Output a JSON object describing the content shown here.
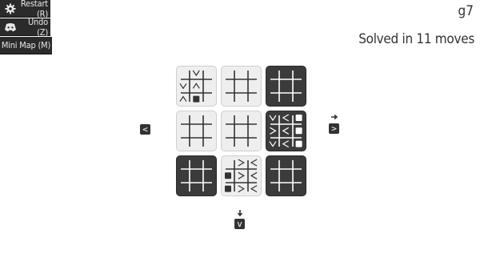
{
  "menu": {
    "restart_label": "Restart (R)",
    "undo_label": "Undo (Z)",
    "minimap_label": "Mini Map (M)",
    "restart_icon": "gear-icon",
    "undo_icon": "discord-icon"
  },
  "status": {
    "level": "g7",
    "solved_text": "Solved in 11 moves"
  },
  "board": {
    "rows": 3,
    "cols": 3,
    "tiles": [
      {
        "shade": "light",
        "marks": [
          [
            0,
            1,
            "v"
          ],
          [
            1,
            0,
            "v"
          ],
          [
            1,
            1,
            "^"
          ],
          [
            2,
            0,
            "^"
          ],
          [
            2,
            1,
            "sq"
          ]
        ]
      },
      {
        "shade": "light",
        "marks": []
      },
      {
        "shade": "dark",
        "marks": []
      },
      {
        "shade": "light",
        "marks": []
      },
      {
        "shade": "light",
        "marks": []
      },
      {
        "shade": "dark",
        "marks": [
          [
            0,
            0,
            "v"
          ],
          [
            0,
            1,
            "<"
          ],
          [
            0,
            2,
            "sq"
          ],
          [
            1,
            0,
            ">"
          ],
          [
            1,
            1,
            "<"
          ],
          [
            1,
            2,
            "sq"
          ],
          [
            2,
            0,
            "v"
          ],
          [
            2,
            1,
            "<"
          ],
          [
            2,
            2,
            "sq"
          ]
        ]
      },
      {
        "shade": "dark",
        "marks": []
      },
      {
        "shade": "light",
        "marks": [
          [
            0,
            1,
            ">"
          ],
          [
            0,
            2,
            "<"
          ],
          [
            1,
            0,
            "sq"
          ],
          [
            1,
            1,
            ">"
          ],
          [
            1,
            2,
            "<"
          ],
          [
            2,
            0,
            "sq"
          ],
          [
            2,
            1,
            ">"
          ],
          [
            2,
            2,
            "<"
          ]
        ]
      },
      {
        "shade": "dark",
        "marks": []
      }
    ]
  },
  "nav": {
    "left_key": "<",
    "right_key": ">",
    "down_key": "v"
  },
  "colors": {
    "light_tile": "#eeeeee",
    "dark_tile": "#3b3b3b",
    "menu_bg": "#2b2b2b"
  }
}
